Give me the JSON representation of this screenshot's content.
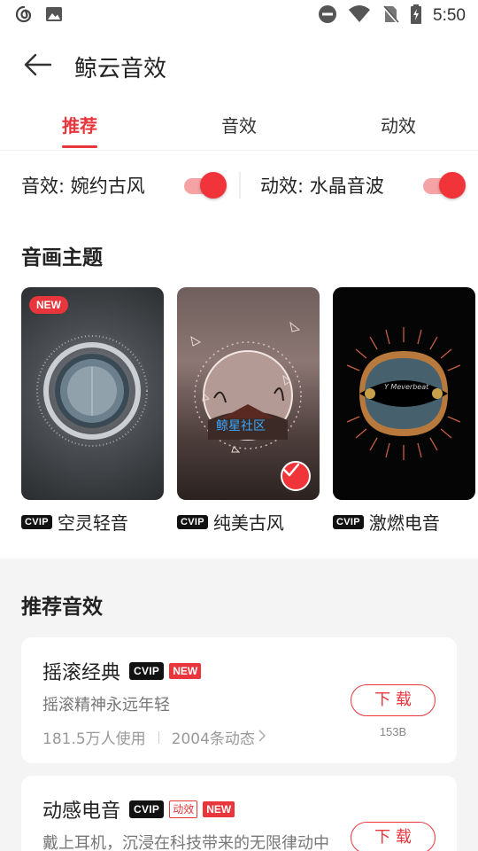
{
  "status_bar": {
    "time": "5:50"
  },
  "header": {
    "title": "鲸云音效"
  },
  "tabs": [
    {
      "label": "推荐",
      "active": true
    },
    {
      "label": "音效",
      "active": false
    },
    {
      "label": "动效",
      "active": false
    }
  ],
  "toggles": [
    {
      "label": "音效: 婉约古风",
      "on": true
    },
    {
      "label": "动效: 水晶音波",
      "on": true
    }
  ],
  "themes_section": {
    "title": "音画主题",
    "items": [
      {
        "name": "空灵轻音",
        "badge": "NEW",
        "selected": false
      },
      {
        "name": "纯美古风",
        "overlay_text": "鲸星社区",
        "selected": true
      },
      {
        "name": "激燃电音",
        "overlay_text": "Y Meverbeat",
        "selected": false
      }
    ]
  },
  "vip_label": "CVIP",
  "recommend_section": {
    "title": "推荐音效",
    "items": [
      {
        "name": "摇滚经典",
        "tags": [
          "NEW"
        ],
        "desc": "摇滚精神永远年轻",
        "users": "181.5万人使用",
        "posts": "2004条动态",
        "button": "下 载",
        "size": "153B"
      },
      {
        "name": "动感电音",
        "tag_outline": "动效",
        "tags": [
          "NEW"
        ],
        "desc": "戴上耳机，沉浸在科技带来的无限律动中",
        "button": "下 载"
      }
    ]
  },
  "colors": {
    "accent": "#e8363c",
    "switch_track": "#f5a3a5"
  }
}
